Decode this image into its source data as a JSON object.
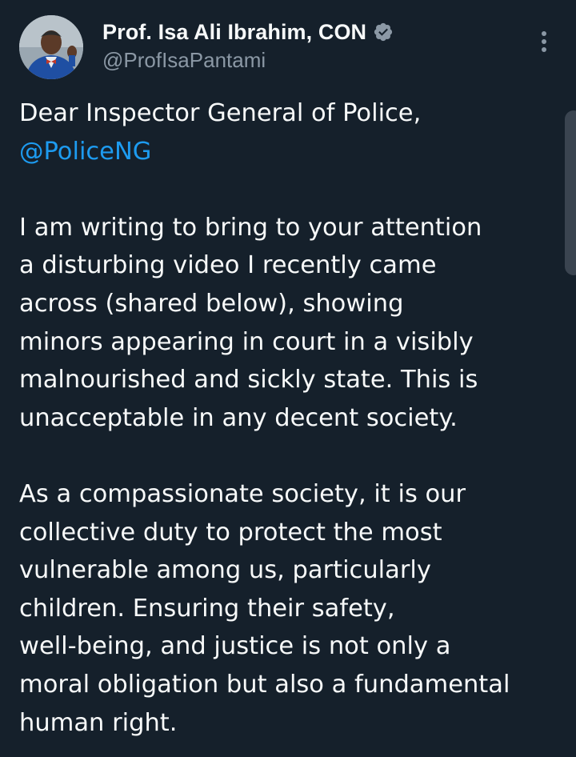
{
  "author": {
    "display_name": "Prof. Isa Ali Ibrahim, CON",
    "handle": "@ProfIsaPantami",
    "verified_icon": "verified-badge-icon",
    "verified_color": "#8b98a5"
  },
  "menu": {
    "icon": "more-vertical-icon"
  },
  "colors": {
    "background": "#15202b",
    "text": "#f7f9f9",
    "secondary_text": "#8b98a5",
    "link": "#1d9bf0"
  },
  "tweet": {
    "greeting": "Dear Inspector General of Police,",
    "mention": "@PoliceNG",
    "paragraph1": [
      "I am writing to bring to your attention",
      "a disturbing video I recently came",
      "across (shared below), showing",
      "minors appearing in court in a visibly",
      "malnourished and sickly state. This is",
      "unacceptable in any decent society."
    ],
    "paragraph2": [
      "As a compassionate society, it is our",
      "collective duty to protect the most",
      "vulnerable among us, particularly",
      "children. Ensuring their safety,",
      "well-being, and justice is not only a",
      "moral obligation but also a fundamental",
      "human right."
    ]
  }
}
